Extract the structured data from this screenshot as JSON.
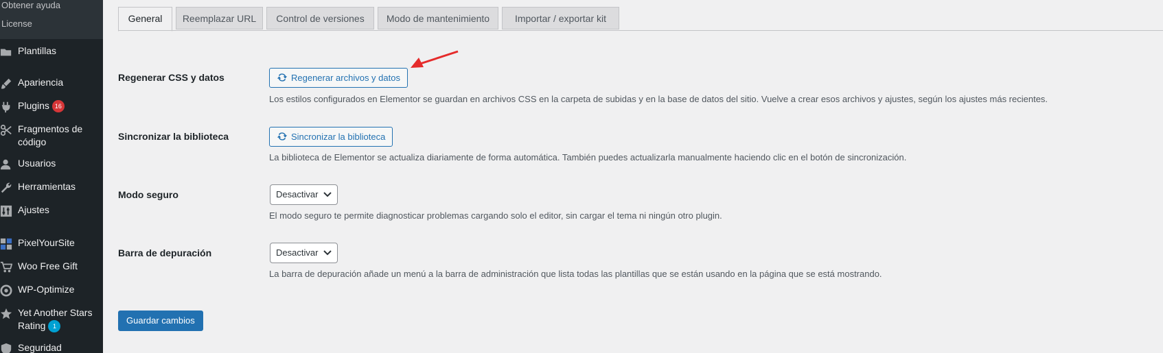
{
  "sidebar": {
    "submenu": [
      "Obtener ayuda",
      "License"
    ],
    "items": [
      {
        "label": "Plantillas",
        "icon": "folder-icon"
      },
      {
        "label": "Apariencia",
        "icon": "paintbrush-icon"
      },
      {
        "label": "Plugins",
        "icon": "plugin-icon",
        "badge": "16"
      },
      {
        "label": "Fragmentos de código",
        "icon": "scissors-icon"
      },
      {
        "label": "Usuarios",
        "icon": "user-icon"
      },
      {
        "label": "Herramientas",
        "icon": "wrench-icon"
      },
      {
        "label": "Ajustes",
        "icon": "settings-sliders-icon"
      },
      {
        "label": "PixelYourSite",
        "icon": "pixelyoursite-icon"
      },
      {
        "label": "Woo Free Gift",
        "icon": "cart-icon"
      },
      {
        "label": "WP-Optimize",
        "icon": "optimize-icon"
      },
      {
        "label": "Yet Another Stars Rating",
        "icon": "star-icon",
        "badge": "1"
      },
      {
        "label": "Seguridad",
        "icon": "shield-icon"
      }
    ]
  },
  "tabs": [
    "General",
    "Reemplazar URL",
    "Control de versiones",
    "Modo de mantenimiento",
    "Importar / exportar kit"
  ],
  "active_tab": "General",
  "rows": {
    "regenerate": {
      "label": "Regenerar CSS y datos",
      "button": "Regenerar archivos y datos",
      "description": "Los estilos configurados en Elementor se guardan en archivos CSS en la carpeta de subidas y en la base de datos del sitio. Vuelve a crear esos archivos y ajustes, según los ajustes más recientes."
    },
    "sync": {
      "label": "Sincronizar la biblioteca",
      "button": "Sincronizar la biblioteca",
      "description": "La biblioteca de Elementor se actualiza diariamente de forma automática. También puedes actualizarla manualmente haciendo clic en el botón de sincronización."
    },
    "safe_mode": {
      "label": "Modo seguro",
      "value": "Desactivar",
      "description": "El modo seguro te permite diagnosticar problemas cargando solo el editor, sin cargar el tema ni ningún otro plugin."
    },
    "debug_bar": {
      "label": "Barra de depuración",
      "value": "Desactivar",
      "description": "La barra de depuración añade un menú a la barra de administración que lista todas las plantillas que se están usando en la página que se está mostrando."
    }
  },
  "save_label": "Guardar cambios",
  "colors": {
    "sidebar_bg": "#1d2327",
    "accent": "#2271b1",
    "badge_red": "#d63638",
    "badge_blue": "#00a0d2",
    "annotation_arrow": "#e52b2b"
  }
}
